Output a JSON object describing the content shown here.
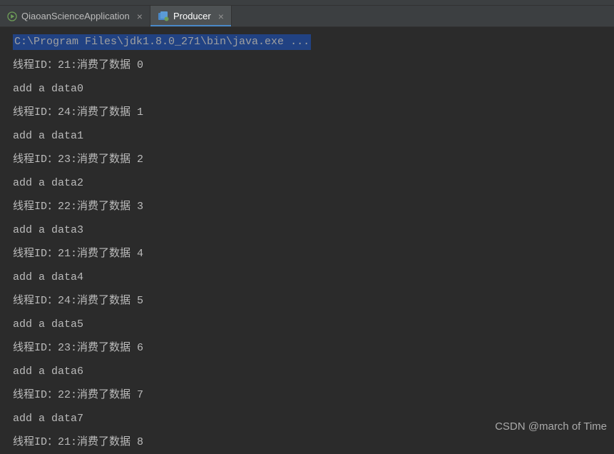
{
  "tabs": [
    {
      "label": "QiaoanScienceApplication",
      "active": false,
      "icon": "run-green"
    },
    {
      "label": "Producer",
      "active": true,
      "icon": "class-blue"
    }
  ],
  "selected_header": "C:\\Program Files\\jdk1.8.0_271\\bin\\java.exe ...",
  "console_lines": [
    "线程ID：21:消费了数据 0",
    "add a data0",
    "线程ID：24:消费了数据 1",
    "add a data1",
    "线程ID：23:消费了数据 2",
    "add a data2",
    "线程ID：22:消费了数据 3",
    "add a data3",
    "线程ID：21:消费了数据 4",
    "add a data4",
    "线程ID：24:消费了数据 5",
    "add a data5",
    "线程ID：23:消费了数据 6",
    "add a data6",
    "线程ID：22:消费了数据 7",
    "add a data7",
    "线程ID：21:消费了数据 8"
  ],
  "watermark": "CSDN @march of Time"
}
